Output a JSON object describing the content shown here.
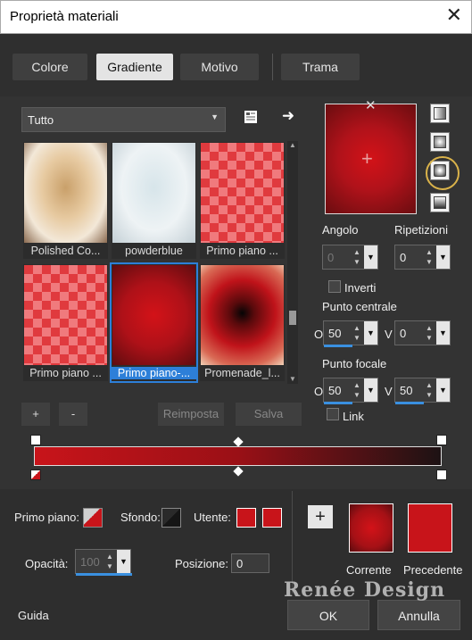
{
  "window": {
    "title": "Proprietà materiali",
    "close_label": "✕"
  },
  "tabs": [
    {
      "label": "Colore"
    },
    {
      "label": "Gradiente"
    },
    {
      "label": "Motivo"
    },
    {
      "label": "Trama"
    }
  ],
  "active_tab": "Gradiente",
  "category": {
    "selected": "Tutto"
  },
  "gradients": [
    {
      "label": "Polished Co..."
    },
    {
      "label": "powderblue"
    },
    {
      "label": "Primo piano ..."
    },
    {
      "label": "Primo piano ..."
    },
    {
      "label": "Primo piano-..."
    },
    {
      "label": "Promenade_l..."
    }
  ],
  "selected_gradient_index": 4,
  "list_buttons": {
    "add": "+",
    "remove": "-",
    "reset": "Reimposta",
    "save": "Salva"
  },
  "angle": {
    "label": "Angolo",
    "value": "0"
  },
  "repeats": {
    "label": "Ripetizioni",
    "value": "0"
  },
  "invert": {
    "label": "Inverti",
    "checked": false
  },
  "center_point": {
    "label": "Punto centrale",
    "o_label": "O",
    "o_value": "50",
    "v_label": "V",
    "v_value": "0"
  },
  "focal_point": {
    "label": "Punto focale",
    "o_label": "O",
    "o_value": "50",
    "v_label": "V",
    "v_value": "50"
  },
  "link": {
    "label": "Link",
    "checked": false
  },
  "colors": {
    "foreground": "#c8141a",
    "gradient_start": "#c8141a",
    "gradient_end": "#1d1214",
    "accent": "#2d7fd8",
    "highlight_circle": "#d9b24a"
  },
  "material": {
    "foreground_label": "Primo piano:",
    "background_label": "Sfondo:",
    "user_label": "Utente:",
    "opacity_label": "Opacità:",
    "opacity_value": "100",
    "position_label": "Posizione:",
    "position_value": "0"
  },
  "compare": {
    "current_label": "Corrente",
    "previous_label": "Precedente",
    "add": "+"
  },
  "footer": {
    "help": "Guida",
    "ok": "OK",
    "cancel": "Annulla"
  },
  "watermark": "Renée Design"
}
